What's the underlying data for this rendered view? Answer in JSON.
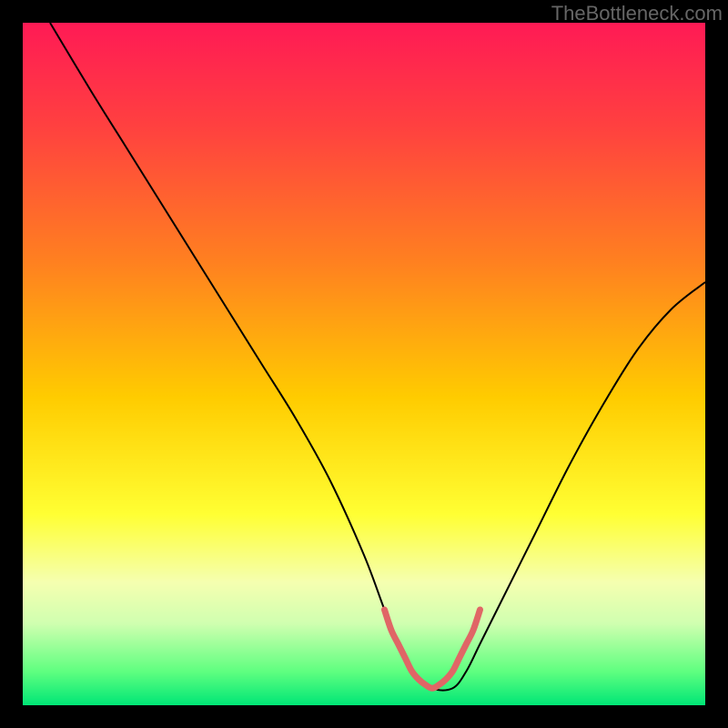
{
  "watermark": "TheBottleneck.com",
  "chart_data": {
    "type": "line",
    "title": "",
    "xlabel": "",
    "ylabel": "",
    "xlim": [
      0,
      100
    ],
    "ylim": [
      0,
      100
    ],
    "background_gradient": {
      "stops": [
        {
          "offset": 0.0,
          "color": "#ff1a55"
        },
        {
          "offset": 0.15,
          "color": "#ff4040"
        },
        {
          "offset": 0.35,
          "color": "#ff8020"
        },
        {
          "offset": 0.55,
          "color": "#ffcc00"
        },
        {
          "offset": 0.72,
          "color": "#ffff33"
        },
        {
          "offset": 0.82,
          "color": "#f5ffb0"
        },
        {
          "offset": 0.88,
          "color": "#d0ffb0"
        },
        {
          "offset": 0.95,
          "color": "#60ff80"
        },
        {
          "offset": 1.0,
          "color": "#00e676"
        }
      ]
    },
    "series": [
      {
        "name": "bottleneck-curve",
        "color": "#000000",
        "width": 2,
        "x": [
          4,
          10,
          15,
          20,
          25,
          30,
          35,
          40,
          45,
          50,
          53,
          55,
          57,
          60,
          63,
          65,
          67,
          70,
          75,
          80,
          85,
          90,
          95,
          100
        ],
        "values": [
          100,
          90,
          82,
          74,
          66,
          58,
          50,
          42,
          33,
          22,
          14,
          9,
          5,
          2.5,
          2.5,
          5,
          9,
          15,
          25,
          35,
          44,
          52,
          58,
          62
        ]
      },
      {
        "name": "optimal-zone-marker",
        "color": "#e06666",
        "width": 7,
        "x": [
          53,
          54,
          55,
          56,
          57,
          58,
          59,
          60,
          61,
          62,
          63,
          64,
          65,
          66,
          67
        ],
        "values": [
          14,
          11,
          9,
          7,
          5,
          3.8,
          3,
          2.5,
          3,
          3.8,
          5,
          7,
          9,
          11,
          14
        ]
      }
    ]
  }
}
